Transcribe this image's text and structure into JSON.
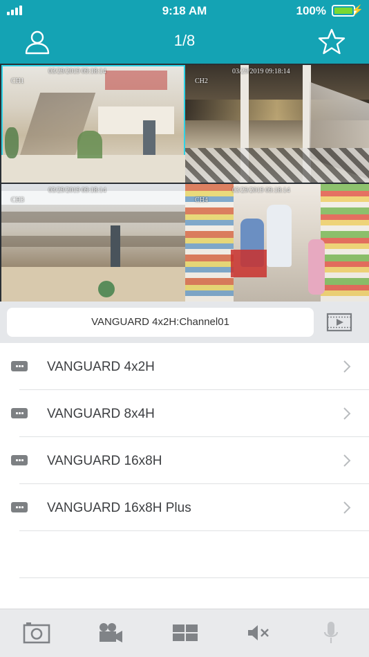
{
  "status_bar": {
    "time": "9:18 AM",
    "battery_percent": "100%",
    "battery_level": 1.0
  },
  "nav": {
    "title": "1/8",
    "left_icon": "user-icon",
    "right_icon": "star-icon"
  },
  "video_grid": {
    "tiles": [
      {
        "channel": "CH1",
        "timestamp": "03/29/2019  09:18:14",
        "selected": true
      },
      {
        "channel": "CH2",
        "timestamp": "03/29/2019  09:18:14",
        "selected": false
      },
      {
        "channel": "CH3",
        "timestamp": "03/29/2019  09:18:14",
        "selected": false
      },
      {
        "channel": "CH4",
        "timestamp": "03/29/2019  09:18:14",
        "selected": false
      }
    ]
  },
  "channel_bar": {
    "current": "VANGUARD 4x2H:Channel01",
    "playback_icon": "playback-video-icon"
  },
  "devices": [
    {
      "name": "VANGUARD 4x2H",
      "icon": "dvr-device-icon"
    },
    {
      "name": "VANGUARD 8x4H",
      "icon": "dvr-device-icon"
    },
    {
      "name": "VANGUARD 16x8H",
      "icon": "dvr-device-icon"
    },
    {
      "name": "VANGUARD 16x8H Plus",
      "icon": "dvr-device-icon"
    }
  ],
  "toolbar": {
    "icons": [
      "camera-snapshot-icon",
      "video-record-icon",
      "grid-layout-icon",
      "speaker-mute-icon",
      "microphone-icon"
    ]
  },
  "colors": {
    "accent": "#14a3b4",
    "selected_tile_border": "#2fd3e6",
    "battery": "#7ad832"
  }
}
